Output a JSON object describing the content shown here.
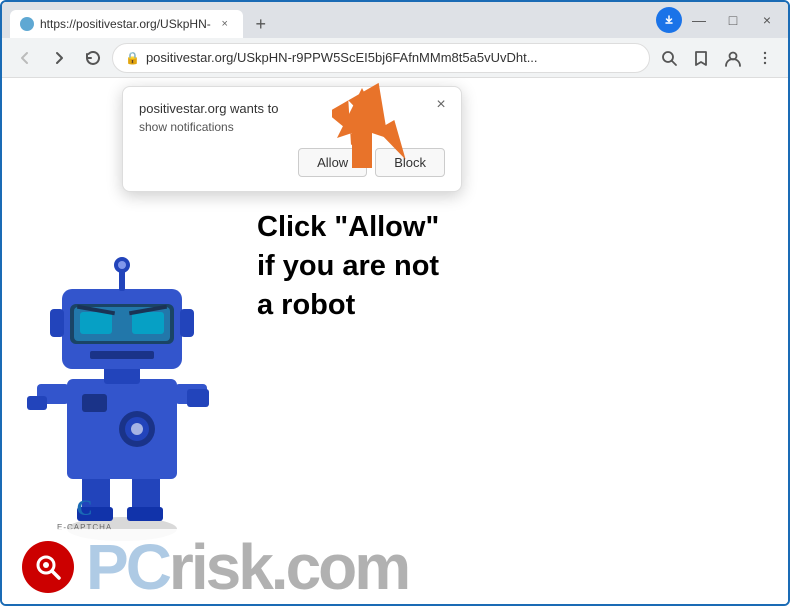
{
  "browser": {
    "tab": {
      "title": "https://positivestar.org/USkpHN-",
      "favicon": "globe"
    },
    "address": "positivestar.org/USkpHN-r9PPW5ScEI5bj6FAfnMMm8t5a5vUvDht...",
    "new_tab_label": "+",
    "window_controls": {
      "minimize": "—",
      "maximize": "□",
      "close": "×"
    }
  },
  "toolbar": {
    "back_label": "←",
    "forward_label": "→",
    "close_label": "×",
    "search_icon_label": "🔍",
    "star_icon_label": "☆",
    "account_icon_label": "👤",
    "menu_icon_label": "⋮"
  },
  "notification_popup": {
    "title": "positivestar.org wants to",
    "subtitle": "show notifications",
    "allow_label": "Allow",
    "block_label": "Block",
    "close_label": "×"
  },
  "page": {
    "instruction_line1": "Click \"Allow\"",
    "instruction_line2": "if you are not",
    "instruction_line3": "a robot"
  },
  "watermark": {
    "brand": "PC",
    "dot": "risk",
    "tld": ".com",
    "icon_letter": "🔍"
  },
  "ecaptcha": {
    "label": "E-CAPTCHA"
  },
  "colors": {
    "browser_border": "#1a6bb5",
    "toolbar_bg": "#f1f3f4",
    "tab_bg": "#dee1e6",
    "active_tab_bg": "#ffffff",
    "arrow_color": "#e8732a",
    "robot_body": "#3355cc",
    "instruction_color": "#000000",
    "pcrisk_blue": "#1a6bb5"
  }
}
